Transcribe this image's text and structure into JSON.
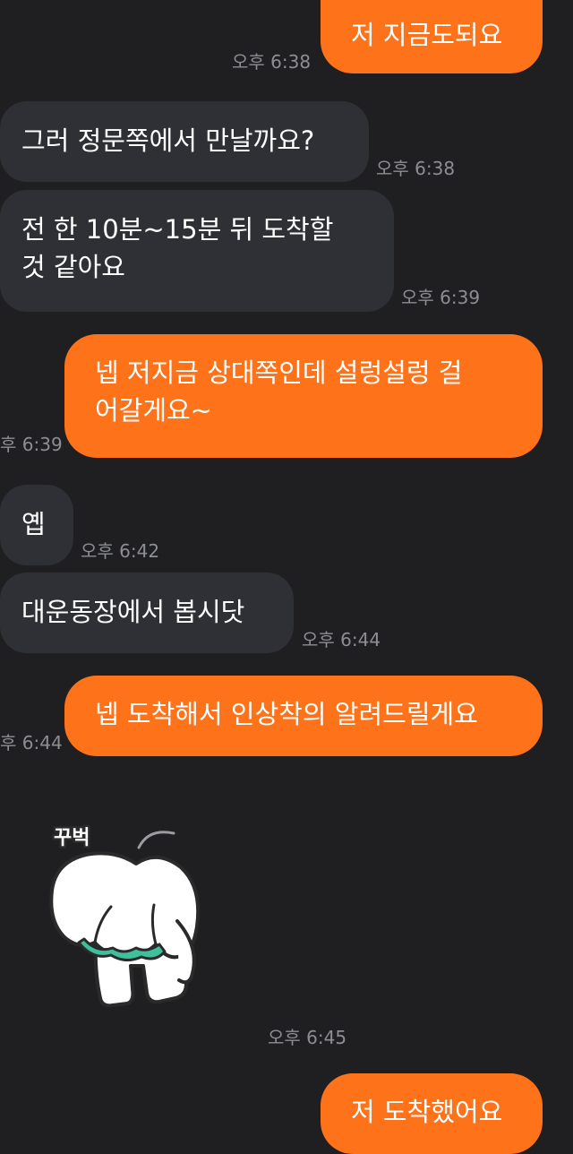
{
  "messages": [
    {
      "text": "저 지금도되요",
      "time": "오후 6:38"
    },
    {
      "text": "그러 정문쪽에서 만날까요?",
      "time": "오후 6:38"
    },
    {
      "text": "전 한 10분~15분 뒤 도착할\n것 같아요",
      "time": "오후 6:39"
    },
    {
      "text": "넵 저지금 상대쪽인데 설렁설렁 걸\n어갈게요~",
      "time": "후 6:39"
    },
    {
      "text": "옙",
      "time": "오후 6:42"
    },
    {
      "text": "대운동장에서 봅시닷",
      "time": "오후 6:44"
    },
    {
      "text": "넵 도착해서 인상착의 알려드릴게요",
      "time": "후 6:44"
    },
    {
      "text": "저 도착했어요",
      "time": ""
    }
  ],
  "sticker": {
    "caption": "꾸벅",
    "time": "오후 6:45"
  },
  "colors": {
    "background": "#1f1f21",
    "incoming_bubble": "#2e3035",
    "outgoing_bubble": "#fe7219",
    "timestamp": "#8c8e93"
  }
}
